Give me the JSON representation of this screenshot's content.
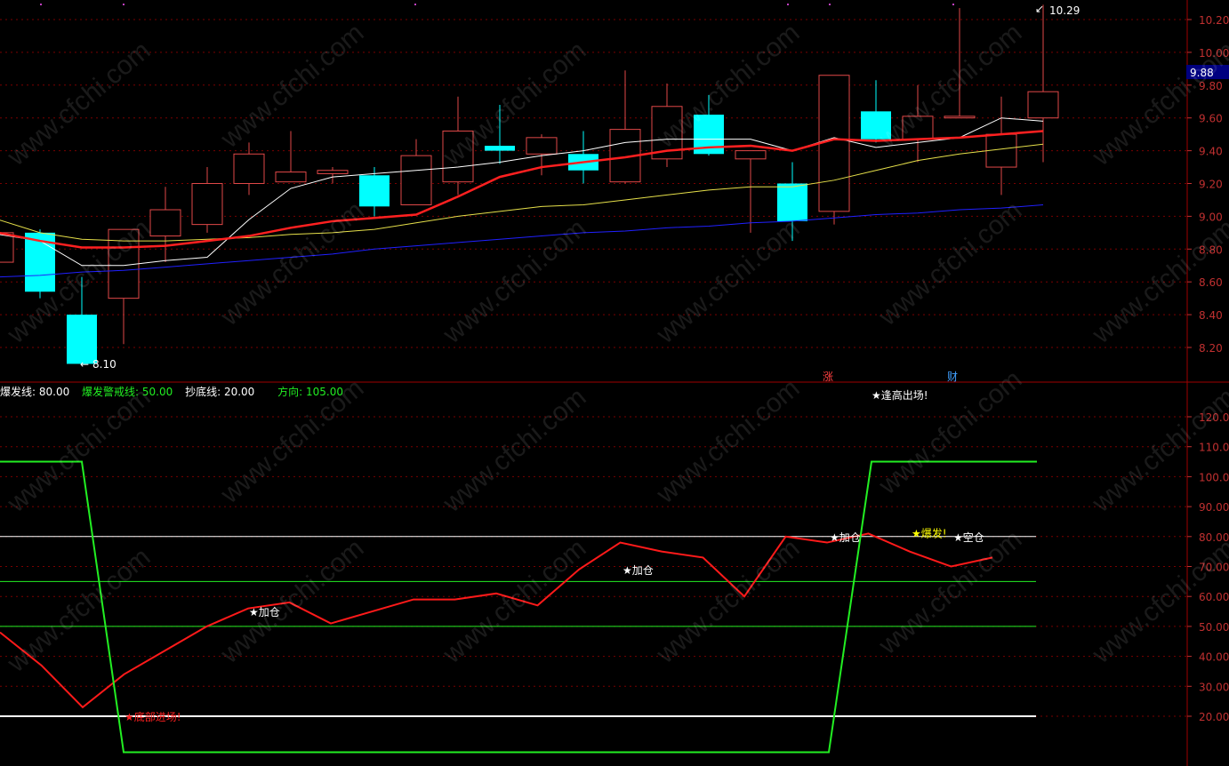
{
  "watermark": "www.cfchi.com",
  "colors": {
    "bg": "#000000",
    "grid": "#7a0000",
    "axis_text": "#c03030",
    "up_candle": "#e04848",
    "down_candle": "#00ffff",
    "ma_white": "#ffffff",
    "ma_red": "#ff2020",
    "ma_yellow": "#e6e04a",
    "ma_blue": "#2020ff",
    "osc_red": "#ff1a1a",
    "osc_green": "#22ee22",
    "price_tag_bg": "#000080"
  },
  "price_panel": {
    "y_ticks": [
      "10.20",
      "10.00",
      "9.80",
      "9.60",
      "9.40",
      "9.20",
      "9.00",
      "8.80",
      "8.60",
      "8.40",
      "8.20"
    ],
    "current_price_tag": "9.88",
    "high_label": "10.29",
    "low_label": "8.10",
    "markers": [
      {
        "text": "涨",
        "color": "#ff4040"
      },
      {
        "text": "财",
        "color": "#40a0ff"
      }
    ]
  },
  "indicator_panel": {
    "legend": [
      {
        "text": "爆发线: 80.00",
        "color": "#ffffff"
      },
      {
        "text": "爆发警戒线: 50.00",
        "color": "#22ee22"
      },
      {
        "text": "抄底线: 20.00",
        "color": "#ffffff"
      },
      {
        "text": "方向: 105.00",
        "color": "#22ee22"
      }
    ],
    "y_ticks": [
      "120.00",
      "110.00",
      "100.00",
      "90.00",
      "80.00",
      "70.00",
      "60.00",
      "50.00",
      "40.00",
      "30.00",
      "20.00"
    ],
    "annotations": [
      {
        "text": "★底部进场!",
        "color": "#ff2020"
      },
      {
        "text": "★加仓",
        "color": "#ffffff"
      },
      {
        "text": "★加仓",
        "color": "#ffffff"
      },
      {
        "text": "★加仓",
        "color": "#ffffff"
      },
      {
        "text": "★爆发!",
        "color": "#ffff00"
      },
      {
        "text": "★空仓",
        "color": "#ffffff"
      },
      {
        "text": "★逢高出场!",
        "color": "#ffffff"
      }
    ]
  },
  "chart_data": [
    {
      "type": "candlestick",
      "ylim": [
        8.0,
        10.35
      ],
      "candles": [
        {
          "o": 8.72,
          "h": 8.95,
          "l": 8.72,
          "c": 8.9
        },
        {
          "o": 8.9,
          "h": 8.92,
          "l": 8.5,
          "c": 8.54
        },
        {
          "o": 8.4,
          "h": 8.63,
          "l": 8.1,
          "c": 8.1
        },
        {
          "o": 8.5,
          "h": 8.92,
          "l": 8.22,
          "c": 8.92
        },
        {
          "o": 8.88,
          "h": 9.18,
          "l": 8.72,
          "c": 9.04
        },
        {
          "o": 8.95,
          "h": 9.3,
          "l": 8.9,
          "c": 9.2
        },
        {
          "o": 9.2,
          "h": 9.45,
          "l": 9.13,
          "c": 9.38
        },
        {
          "o": 9.21,
          "h": 9.52,
          "l": 9.21,
          "c": 9.27
        },
        {
          "o": 9.26,
          "h": 9.3,
          "l": 9.2,
          "c": 9.28
        },
        {
          "o": 9.25,
          "h": 9.3,
          "l": 9.0,
          "c": 9.06
        },
        {
          "o": 9.07,
          "h": 9.47,
          "l": 9.07,
          "c": 9.37
        },
        {
          "o": 9.21,
          "h": 9.73,
          "l": 9.13,
          "c": 9.52
        },
        {
          "o": 9.43,
          "h": 9.68,
          "l": 9.32,
          "c": 9.4
        },
        {
          "o": 9.38,
          "h": 9.5,
          "l": 9.25,
          "c": 9.48
        },
        {
          "o": 9.38,
          "h": 9.52,
          "l": 9.2,
          "c": 9.28
        },
        {
          "o": 9.21,
          "h": 9.89,
          "l": 9.2,
          "c": 9.53
        },
        {
          "o": 9.35,
          "h": 9.81,
          "l": 9.3,
          "c": 9.67
        },
        {
          "o": 9.62,
          "h": 9.74,
          "l": 9.37,
          "c": 9.38
        },
        {
          "o": 9.35,
          "h": 9.4,
          "l": 8.9,
          "c": 9.4
        },
        {
          "o": 9.2,
          "h": 9.33,
          "l": 8.85,
          "c": 8.97
        },
        {
          "o": 9.03,
          "h": 9.86,
          "l": 8.95,
          "c": 9.86
        },
        {
          "o": 9.64,
          "h": 9.83,
          "l": 9.45,
          "c": 9.47
        },
        {
          "o": 9.47,
          "h": 9.8,
          "l": 9.33,
          "c": 9.61
        },
        {
          "o": 9.6,
          "h": 10.27,
          "l": 9.6,
          "c": 9.61
        },
        {
          "o": 9.3,
          "h": 9.73,
          "l": 9.13,
          "c": 9.5
        },
        {
          "o": 9.6,
          "h": 10.29,
          "l": 9.33,
          "c": 9.76
        }
      ],
      "ma_short": [
        8.89,
        8.85,
        8.7,
        8.7,
        8.73,
        8.75,
        8.98,
        9.17,
        9.24,
        9.26,
        9.28,
        9.3,
        9.33,
        9.37,
        9.4,
        9.45,
        9.47,
        9.47,
        9.47,
        9.4,
        9.48,
        9.42,
        9.45,
        9.48,
        9.6,
        9.58
      ],
      "ma_mid": [
        8.9,
        8.85,
        8.81,
        8.81,
        8.82,
        8.85,
        8.88,
        8.93,
        8.97,
        8.99,
        9.01,
        9.12,
        9.24,
        9.3,
        9.33,
        9.36,
        9.4,
        9.42,
        9.43,
        9.4,
        9.47,
        9.46,
        9.47,
        9.48,
        9.5,
        9.52
      ],
      "ma_long": [
        8.98,
        8.9,
        8.86,
        8.85,
        8.85,
        8.86,
        8.87,
        8.89,
        8.9,
        8.92,
        8.96,
        9.0,
        9.03,
        9.06,
        9.07,
        9.1,
        9.13,
        9.16,
        9.18,
        9.18,
        9.22,
        9.28,
        9.34,
        9.38,
        9.41,
        9.44
      ],
      "ma_vlong": [
        8.63,
        8.64,
        8.66,
        8.67,
        8.69,
        8.71,
        8.73,
        8.75,
        8.77,
        8.8,
        8.82,
        8.84,
        8.86,
        8.88,
        8.9,
        8.91,
        8.93,
        8.94,
        8.96,
        8.97,
        8.99,
        9.01,
        9.02,
        9.04,
        9.05,
        9.07
      ]
    },
    {
      "type": "line",
      "ylim": [
        8,
        127
      ],
      "series": [
        {
          "values": [
            48,
            37,
            23,
            34,
            42,
            50,
            56,
            58,
            51,
            55,
            59,
            59,
            61,
            57,
            69,
            78,
            75,
            73,
            60,
            80,
            78,
            81,
            75,
            70,
            73
          ]
        },
        {
          "values": [
            105,
            105,
            8,
            8,
            8,
            8,
            8,
            8,
            8,
            8,
            8,
            8,
            8,
            8,
            8,
            8,
            8,
            8,
            8,
            8,
            105,
            105,
            105,
            105,
            105,
            105
          ]
        }
      ],
      "hlines": [
        {
          "value": 80,
          "color": "#ffffff"
        },
        {
          "value": 65,
          "color": "#22ee22"
        },
        {
          "value": 50,
          "color": "#22ee22"
        },
        {
          "value": 20,
          "color": "#ffffff"
        }
      ]
    }
  ]
}
